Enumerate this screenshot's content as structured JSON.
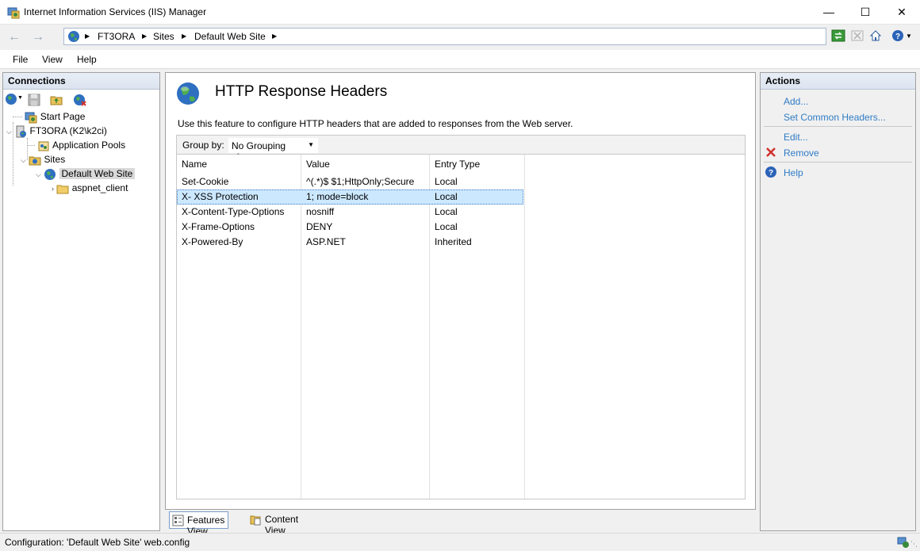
{
  "window": {
    "title": "Internet Information Services (IIS) Manager",
    "minimize_glyph": "—",
    "maximize_glyph": "☐",
    "close_glyph": "✕"
  },
  "address_bar": {
    "crumbs": [
      "FT3ORA",
      "Sites",
      "Default Web Site"
    ]
  },
  "menu": {
    "items": [
      "File",
      "View",
      "Help"
    ]
  },
  "connections": {
    "header": "Connections",
    "tree": {
      "start_page": "Start Page",
      "server": "FT3ORA (K2\\k2ci)",
      "app_pools": "Application Pools",
      "sites": "Sites",
      "default_site": "Default Web Site",
      "aspnet_client": "aspnet_client"
    }
  },
  "main": {
    "title": "HTTP Response Headers",
    "description": "Use this feature to configure HTTP headers that are added to responses from the Web server.",
    "group_by_label": "Group by:",
    "group_by_value": "No Grouping",
    "columns": [
      "Name",
      "Value",
      "Entry Type"
    ],
    "rows": [
      {
        "name": "Set-Cookie",
        "value": "^(.*)$ $1;HttpOnly;Secure",
        "type": "Local"
      },
      {
        "name": "X- XSS Protection",
        "value": "1; mode=block",
        "type": "Local"
      },
      {
        "name": "X-Content-Type-Options",
        "value": "nosniff",
        "type": "Local"
      },
      {
        "name": "X-Frame-Options",
        "value": "DENY",
        "type": "Local"
      },
      {
        "name": "X-Powered-By",
        "value": "ASP.NET",
        "type": "Inherited"
      }
    ],
    "selected_row": 1
  },
  "view_tabs": {
    "features": "Features View",
    "content": "Content View"
  },
  "actions": {
    "header": "Actions",
    "add": "Add...",
    "set_common": "Set Common Headers...",
    "edit": "Edit...",
    "remove": "Remove",
    "help": "Help"
  },
  "status": {
    "text": "Configuration: 'Default Web Site' web.config"
  },
  "colors": {
    "link": "#2f7cc6",
    "selection": "#cce8ff",
    "remove_red": "#d0312d"
  },
  "icons": [
    "iis-app-icon",
    "globe-icon",
    "back-icon",
    "forward-icon",
    "refresh-icon",
    "stop-icon",
    "home-icon",
    "help-icon",
    "save-icon",
    "folder-icon",
    "remove-icon"
  ]
}
